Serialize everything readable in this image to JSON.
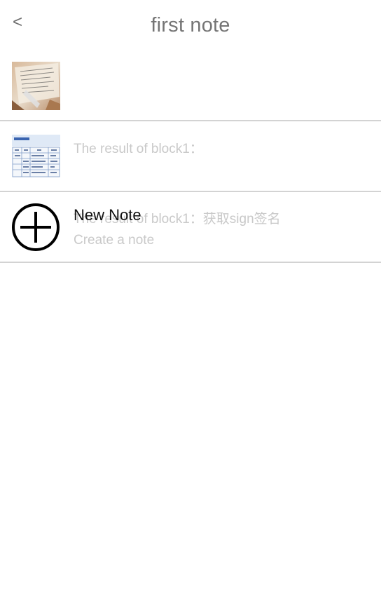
{
  "header": {
    "back_label": "<",
    "title": "first note"
  },
  "notes": [
    {
      "subtitle": "The result of block1：",
      "thumbnail": "notebook-photo-image"
    },
    {
      "subtitle": "The result of block1：获取sign签名",
      "thumbnail": "table-document-image"
    }
  ],
  "new_note": {
    "title": "New Note",
    "subtitle": "Create a note",
    "icon": "plus-circle-icon"
  },
  "colors": {
    "title": "#757575",
    "subtitle": "#c9c9c9",
    "divider": "#d3d3d3",
    "text_dark": "#111111"
  }
}
